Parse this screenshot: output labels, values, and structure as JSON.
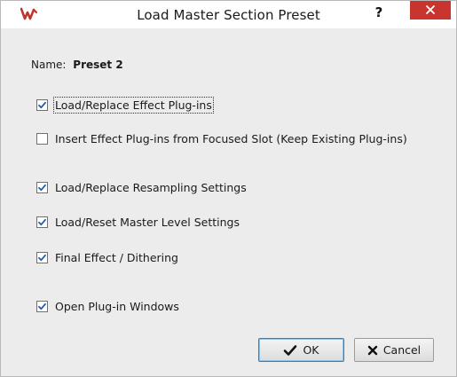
{
  "window": {
    "title": "Load Master Section Preset",
    "help_label": "?",
    "icons": {
      "app": "wavelab-logo-icon",
      "close": "close-icon"
    },
    "close_color": "#c7352e"
  },
  "name": {
    "label": "Name:",
    "value": "Preset 2"
  },
  "options": [
    {
      "label": "Load/Replace Effect Plug-ins",
      "checked": true
    },
    {
      "label": "Insert Effect Plug-ins from Focused Slot (Keep Existing Plug-ins)",
      "checked": false
    },
    {
      "label": "Load/Replace Resampling Settings",
      "checked": true
    },
    {
      "label": "Load/Reset Master Level Settings",
      "checked": true
    },
    {
      "label": "Final Effect / Dithering",
      "checked": true
    },
    {
      "label": "Open Plug-in Windows",
      "checked": true
    }
  ],
  "buttons": {
    "ok": {
      "label": "OK",
      "icon": "checkmark-icon"
    },
    "cancel": {
      "label": "Cancel",
      "icon": "x-icon"
    }
  },
  "colors": {
    "checkbox_tick": "#1f5da8",
    "default_button_border": "#3c7fb1"
  }
}
